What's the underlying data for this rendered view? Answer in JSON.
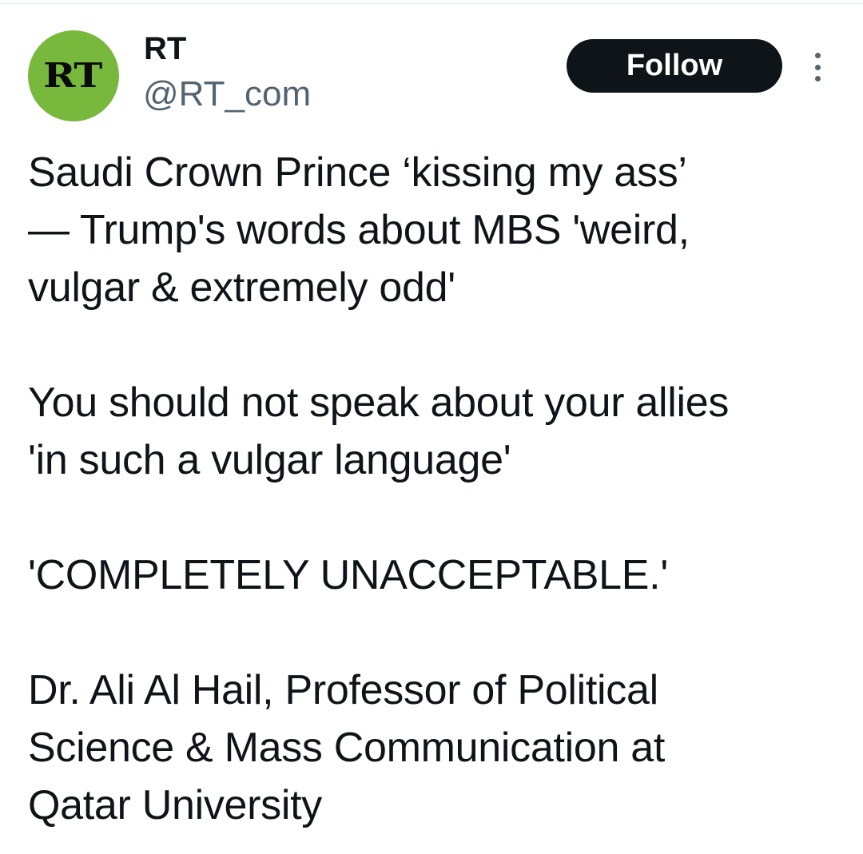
{
  "tweet": {
    "author": {
      "avatar_logo": "RT",
      "display_name": "RT",
      "handle": "@RT_com"
    },
    "follow_label": "Follow",
    "more_icon": "more-vertical-icon",
    "paragraphs": [
      "Saudi Crown Prince ‘kissing my ass’\n— Trump's words about MBS 'weird,\nvulgar & extremely odd'",
      "You should not speak about your allies\n'in such a vulgar language'",
      "'COMPLETELY UNACCEPTABLE.'",
      "Dr. Ali Al Hail, Professor of Political\nScience & Mass Communication at\nQatar University"
    ]
  },
  "colors": {
    "avatar_bg": "#78b83c",
    "follow_bg": "#0f1419",
    "secondary_text": "#536471"
  }
}
